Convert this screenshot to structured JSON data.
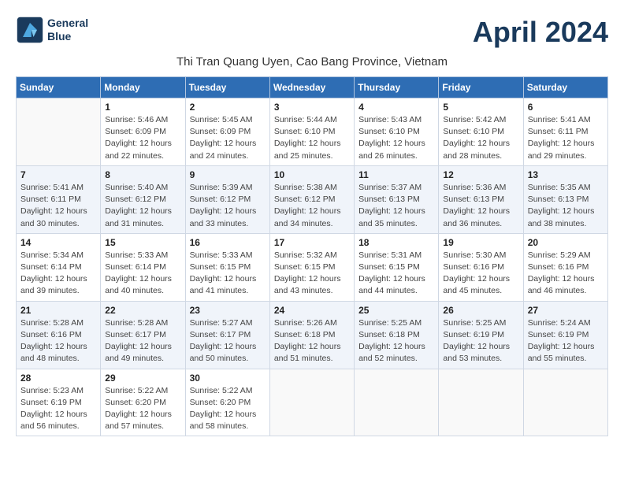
{
  "header": {
    "logo_line1": "General",
    "logo_line2": "Blue",
    "month_year": "April 2024",
    "location": "Thi Tran Quang Uyen, Cao Bang Province, Vietnam"
  },
  "days_of_week": [
    "Sunday",
    "Monday",
    "Tuesday",
    "Wednesday",
    "Thursday",
    "Friday",
    "Saturday"
  ],
  "weeks": [
    [
      {
        "day": "",
        "detail": ""
      },
      {
        "day": "1",
        "detail": "Sunrise: 5:46 AM\nSunset: 6:09 PM\nDaylight: 12 hours\nand 22 minutes."
      },
      {
        "day": "2",
        "detail": "Sunrise: 5:45 AM\nSunset: 6:09 PM\nDaylight: 12 hours\nand 24 minutes."
      },
      {
        "day": "3",
        "detail": "Sunrise: 5:44 AM\nSunset: 6:10 PM\nDaylight: 12 hours\nand 25 minutes."
      },
      {
        "day": "4",
        "detail": "Sunrise: 5:43 AM\nSunset: 6:10 PM\nDaylight: 12 hours\nand 26 minutes."
      },
      {
        "day": "5",
        "detail": "Sunrise: 5:42 AM\nSunset: 6:10 PM\nDaylight: 12 hours\nand 28 minutes."
      },
      {
        "day": "6",
        "detail": "Sunrise: 5:41 AM\nSunset: 6:11 PM\nDaylight: 12 hours\nand 29 minutes."
      }
    ],
    [
      {
        "day": "7",
        "detail": "Sunrise: 5:41 AM\nSunset: 6:11 PM\nDaylight: 12 hours\nand 30 minutes."
      },
      {
        "day": "8",
        "detail": "Sunrise: 5:40 AM\nSunset: 6:12 PM\nDaylight: 12 hours\nand 31 minutes."
      },
      {
        "day": "9",
        "detail": "Sunrise: 5:39 AM\nSunset: 6:12 PM\nDaylight: 12 hours\nand 33 minutes."
      },
      {
        "day": "10",
        "detail": "Sunrise: 5:38 AM\nSunset: 6:12 PM\nDaylight: 12 hours\nand 34 minutes."
      },
      {
        "day": "11",
        "detail": "Sunrise: 5:37 AM\nSunset: 6:13 PM\nDaylight: 12 hours\nand 35 minutes."
      },
      {
        "day": "12",
        "detail": "Sunrise: 5:36 AM\nSunset: 6:13 PM\nDaylight: 12 hours\nand 36 minutes."
      },
      {
        "day": "13",
        "detail": "Sunrise: 5:35 AM\nSunset: 6:13 PM\nDaylight: 12 hours\nand 38 minutes."
      }
    ],
    [
      {
        "day": "14",
        "detail": "Sunrise: 5:34 AM\nSunset: 6:14 PM\nDaylight: 12 hours\nand 39 minutes."
      },
      {
        "day": "15",
        "detail": "Sunrise: 5:33 AM\nSunset: 6:14 PM\nDaylight: 12 hours\nand 40 minutes."
      },
      {
        "day": "16",
        "detail": "Sunrise: 5:33 AM\nSunset: 6:15 PM\nDaylight: 12 hours\nand 41 minutes."
      },
      {
        "day": "17",
        "detail": "Sunrise: 5:32 AM\nSunset: 6:15 PM\nDaylight: 12 hours\nand 43 minutes."
      },
      {
        "day": "18",
        "detail": "Sunrise: 5:31 AM\nSunset: 6:15 PM\nDaylight: 12 hours\nand 44 minutes."
      },
      {
        "day": "19",
        "detail": "Sunrise: 5:30 AM\nSunset: 6:16 PM\nDaylight: 12 hours\nand 45 minutes."
      },
      {
        "day": "20",
        "detail": "Sunrise: 5:29 AM\nSunset: 6:16 PM\nDaylight: 12 hours\nand 46 minutes."
      }
    ],
    [
      {
        "day": "21",
        "detail": "Sunrise: 5:28 AM\nSunset: 6:16 PM\nDaylight: 12 hours\nand 48 minutes."
      },
      {
        "day": "22",
        "detail": "Sunrise: 5:28 AM\nSunset: 6:17 PM\nDaylight: 12 hours\nand 49 minutes."
      },
      {
        "day": "23",
        "detail": "Sunrise: 5:27 AM\nSunset: 6:17 PM\nDaylight: 12 hours\nand 50 minutes."
      },
      {
        "day": "24",
        "detail": "Sunrise: 5:26 AM\nSunset: 6:18 PM\nDaylight: 12 hours\nand 51 minutes."
      },
      {
        "day": "25",
        "detail": "Sunrise: 5:25 AM\nSunset: 6:18 PM\nDaylight: 12 hours\nand 52 minutes."
      },
      {
        "day": "26",
        "detail": "Sunrise: 5:25 AM\nSunset: 6:19 PM\nDaylight: 12 hours\nand 53 minutes."
      },
      {
        "day": "27",
        "detail": "Sunrise: 5:24 AM\nSunset: 6:19 PM\nDaylight: 12 hours\nand 55 minutes."
      }
    ],
    [
      {
        "day": "28",
        "detail": "Sunrise: 5:23 AM\nSunset: 6:19 PM\nDaylight: 12 hours\nand 56 minutes."
      },
      {
        "day": "29",
        "detail": "Sunrise: 5:22 AM\nSunset: 6:20 PM\nDaylight: 12 hours\nand 57 minutes."
      },
      {
        "day": "30",
        "detail": "Sunrise: 5:22 AM\nSunset: 6:20 PM\nDaylight: 12 hours\nand 58 minutes."
      },
      {
        "day": "",
        "detail": ""
      },
      {
        "day": "",
        "detail": ""
      },
      {
        "day": "",
        "detail": ""
      },
      {
        "day": "",
        "detail": ""
      }
    ]
  ]
}
